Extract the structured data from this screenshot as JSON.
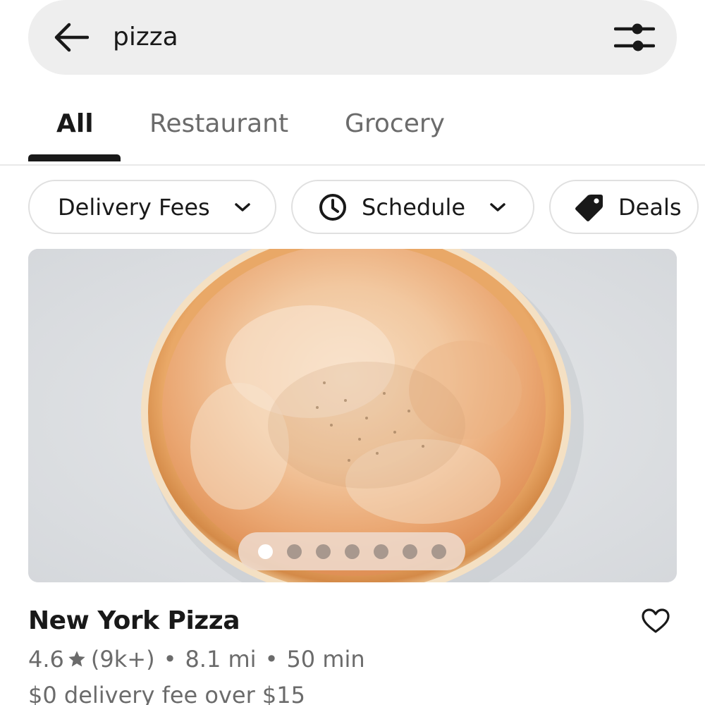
{
  "search": {
    "query": "pizza"
  },
  "tabs": [
    {
      "label": "All",
      "active": true
    },
    {
      "label": "Restaurant",
      "active": false
    },
    {
      "label": "Grocery",
      "active": false
    }
  ],
  "chips": [
    {
      "label": "Delivery Fees",
      "icon": "chevron-down-icon"
    },
    {
      "label": "Schedule",
      "icon": "clock-icon"
    },
    {
      "label": "Deals",
      "icon": "tag-icon"
    }
  ],
  "carousel": {
    "slide_count": 7,
    "active_index": 0
  },
  "store": {
    "name": "New York Pizza",
    "rating": "4.6",
    "rating_count": "(9k+)",
    "distance": "8.1 mi",
    "eta": "50 min",
    "fee": "$0 delivery fee over $15"
  },
  "colors": {
    "text_primary": "#191919",
    "text_secondary": "#6b6b6b",
    "search_bg": "#eeeeee",
    "chip_border": "#e0e0e0"
  }
}
